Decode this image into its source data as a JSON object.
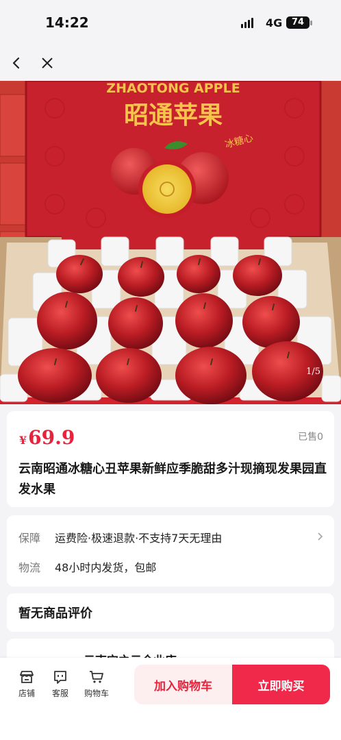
{
  "status": {
    "time": "14:22",
    "network": "4G",
    "battery": "74"
  },
  "product": {
    "image": {
      "counter": "1/5",
      "box_title_en": "ZHAOTONG APPLE",
      "box_title_cn": "昭通苹果"
    },
    "currency": "¥",
    "price": "69.9",
    "sold": "已售0",
    "title": "云南昭通冰糖心丑苹果新鲜应季脆甜多汁现摘现发果园直发水果"
  },
  "service": {
    "guarantee_label": "保障",
    "guarantee_value": "运费险·极速退款·不支持7天无理由",
    "logistics_label": "物流",
    "logistics_value": "48小时内发货，包邮"
  },
  "reviews": {
    "empty_text": "暂无商品评价"
  },
  "shop": {
    "name": "云南宝之云企业店"
  },
  "bottom": {
    "store_label": "店铺",
    "service_label": "客服",
    "cart_label": "购物车",
    "add_to_cart": "加入购物车",
    "buy_now": "立即购买"
  },
  "icons": [
    "back-icon",
    "close-icon",
    "chevron-right-icon",
    "store-icon",
    "customer-service-icon",
    "cart-icon"
  ],
  "colors": {
    "accent": "#f0294a",
    "price": "#e8223b",
    "background": "#f4f4f6"
  }
}
